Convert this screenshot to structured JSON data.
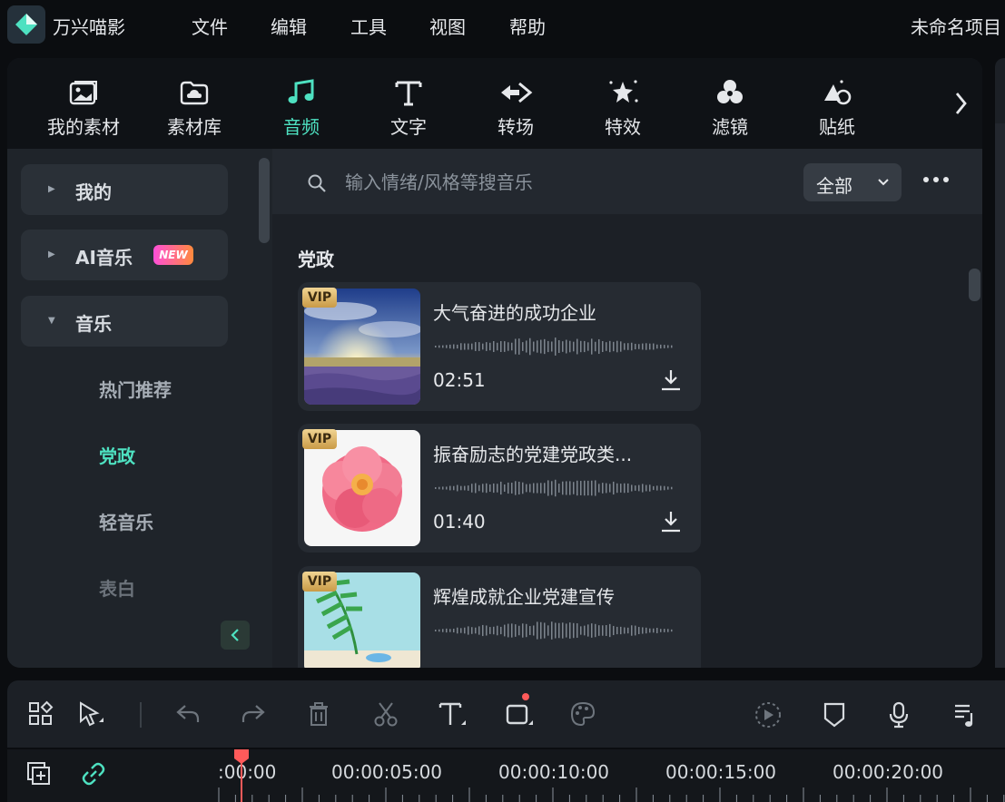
{
  "app": {
    "name": "万兴喵影",
    "project_title": "未命名项目"
  },
  "menu": [
    "文件",
    "编辑",
    "工具",
    "视图",
    "帮助"
  ],
  "toolbar": {
    "tabs": [
      {
        "label": "我的素材",
        "icon": "image-folder-icon"
      },
      {
        "label": "素材库",
        "icon": "cloud-folder-icon"
      },
      {
        "label": "音频",
        "icon": "music-note-icon"
      },
      {
        "label": "文字",
        "icon": "text-t-icon"
      },
      {
        "label": "转场",
        "icon": "transition-arrows-icon"
      },
      {
        "label": "特效",
        "icon": "magic-star-icon"
      },
      {
        "label": "滤镜",
        "icon": "filter-circles-icon"
      },
      {
        "label": "贴纸",
        "icon": "sticker-shapes-icon"
      }
    ],
    "active": "音频"
  },
  "sidebar": {
    "categories": [
      {
        "label": "我的",
        "expanded": false
      },
      {
        "label": "AI音乐",
        "badge": "NEW",
        "expanded": false
      },
      {
        "label": "音乐",
        "expanded": true
      }
    ],
    "subitems": [
      "热门推荐",
      "党政",
      "轻音乐",
      "表白"
    ],
    "active_subitem": "党政"
  },
  "search": {
    "placeholder": "输入情绪/风格等搜音乐",
    "filter_label": "全部"
  },
  "section_title": "党政",
  "tracks": [
    {
      "title": "大气奋进的成功企业",
      "duration": "02:51",
      "badge": "VIP",
      "thumb": "lavender-sunset"
    },
    {
      "title": "振奋励志的党建党政类...",
      "duration": "01:40",
      "badge": "VIP",
      "thumb": "pink-peony"
    },
    {
      "title": "辉煌成就企业党建宣传",
      "duration": "",
      "badge": "VIP",
      "thumb": "palm-leaf-beach"
    }
  ],
  "timeline": {
    "labels": [
      ":00:00",
      "00:00:05:00",
      "00:00:10:00",
      "00:00:15:00",
      "00:00:20:00"
    ]
  },
  "colors": {
    "accent": "#4ee1c1",
    "vip": "#d9b064",
    "playhead": "#ff5a5a"
  }
}
